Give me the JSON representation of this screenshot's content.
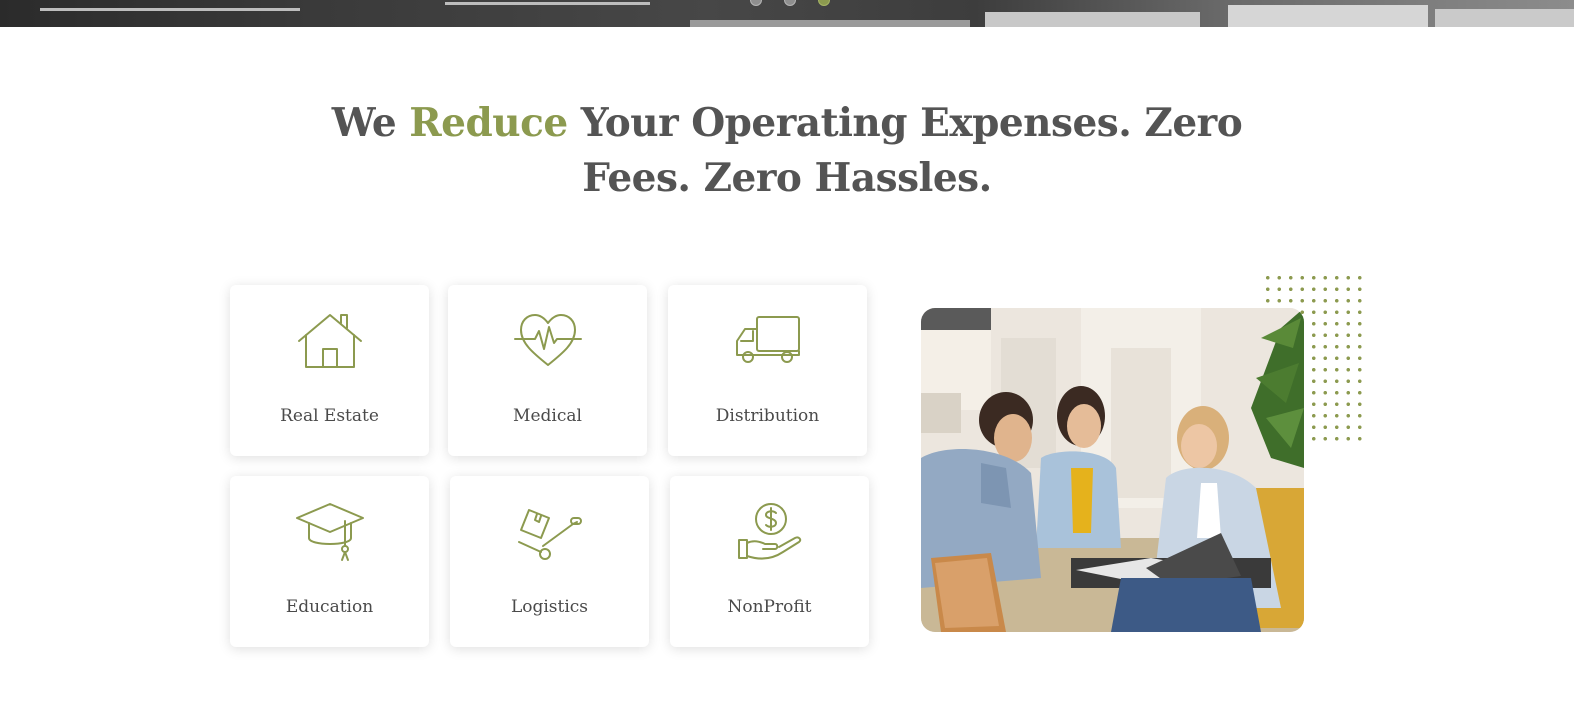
{
  "hero": {
    "slider_dots": 3,
    "active_dot": 3
  },
  "headline": {
    "pre": "We ",
    "accent": "Reduce",
    "post": " Your Operating Expenses. Zero Fees. Zero Hassles."
  },
  "services": [
    {
      "label": "Real Estate",
      "icon": "house-icon"
    },
    {
      "label": "Medical",
      "icon": "heartbeat-icon"
    },
    {
      "label": "Distribution",
      "icon": "delivery-truck-icon"
    },
    {
      "label": "Education",
      "icon": "graduation-cap-icon"
    },
    {
      "label": "Logistics",
      "icon": "hand-truck-icon"
    },
    {
      "label": "NonProfit",
      "icon": "hand-holding-dollar-icon"
    }
  ],
  "photo": {
    "subject": "three-people-reviewing-documents"
  },
  "colors": {
    "accent": "#8c9a4f",
    "heading": "#545454",
    "card_text": "#4a4a4a",
    "background": "#ffffff"
  }
}
